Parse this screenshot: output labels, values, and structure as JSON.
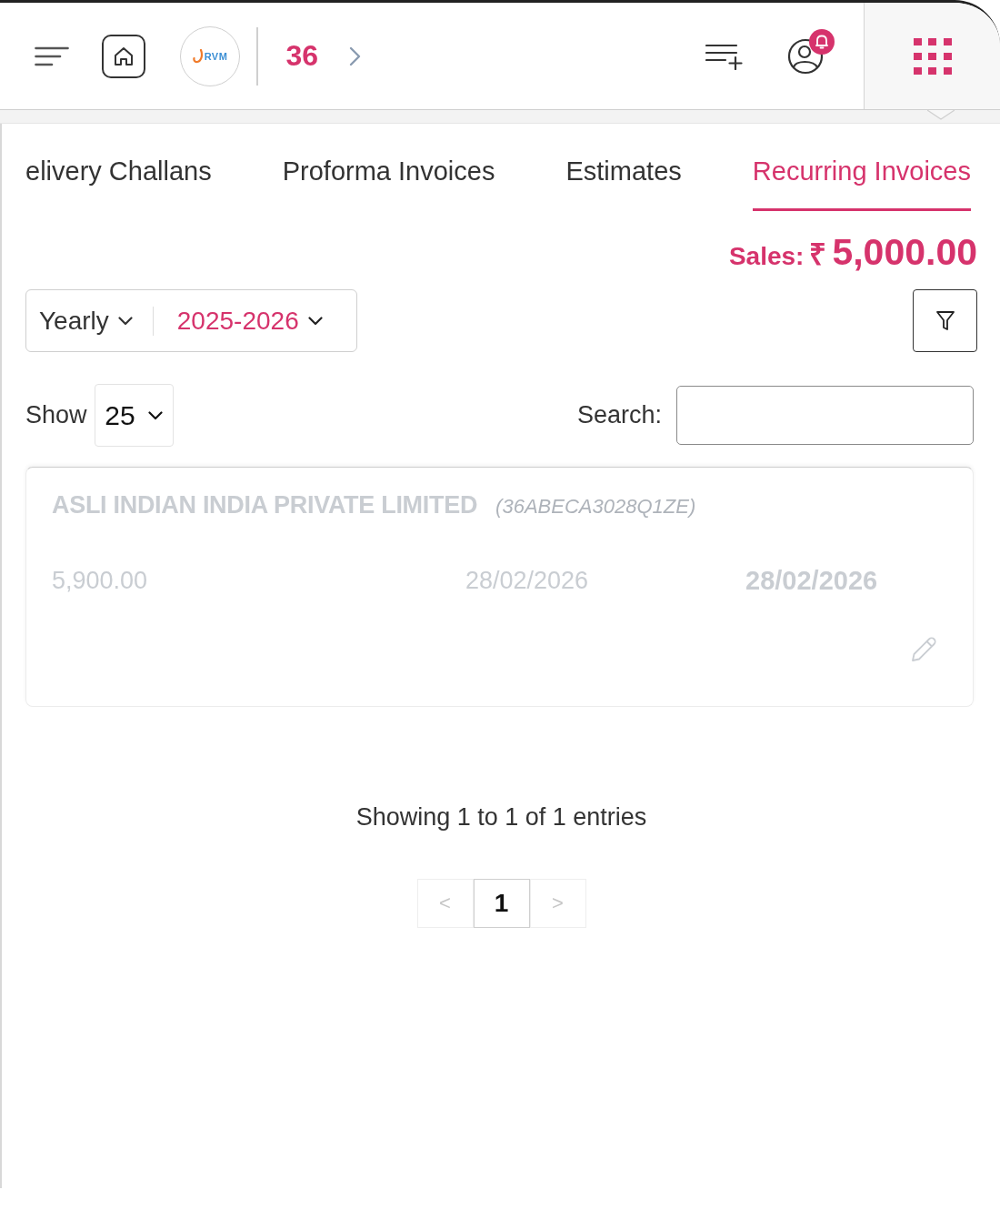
{
  "header": {
    "logo_text": "RVM",
    "count": "36",
    "alert": true
  },
  "tabs": [
    {
      "label": "elivery Challans",
      "selected": false
    },
    {
      "label": "Proforma Invoices",
      "selected": false
    },
    {
      "label": "Estimates",
      "selected": false
    },
    {
      "label": "Recurring Invoices",
      "selected": true
    }
  ],
  "sales": {
    "label": "Sales:",
    "currency": "₹",
    "amount": "5,000.00"
  },
  "period": {
    "type": "Yearly",
    "year": "2025-2026"
  },
  "length_menu": {
    "label": "Show",
    "value": "25"
  },
  "search": {
    "label": "Search:"
  },
  "records": [
    {
      "name": "ASLI INDIAN INDIA PRIVATE LIMITED",
      "gstin": "(36ABECA3028Q1ZE)",
      "amount": "5,900.00",
      "date": "28/02/2026",
      "next_date": "28/02/2026",
      "disabled": true
    }
  ],
  "info": "Showing 1 to 1 of 1 entries",
  "pagination": [
    {
      "label": "<",
      "selected": false,
      "disabled": true
    },
    {
      "label": "1",
      "selected": true,
      "disabled": false
    },
    {
      "label": ">",
      "selected": false,
      "disabled": true
    }
  ]
}
